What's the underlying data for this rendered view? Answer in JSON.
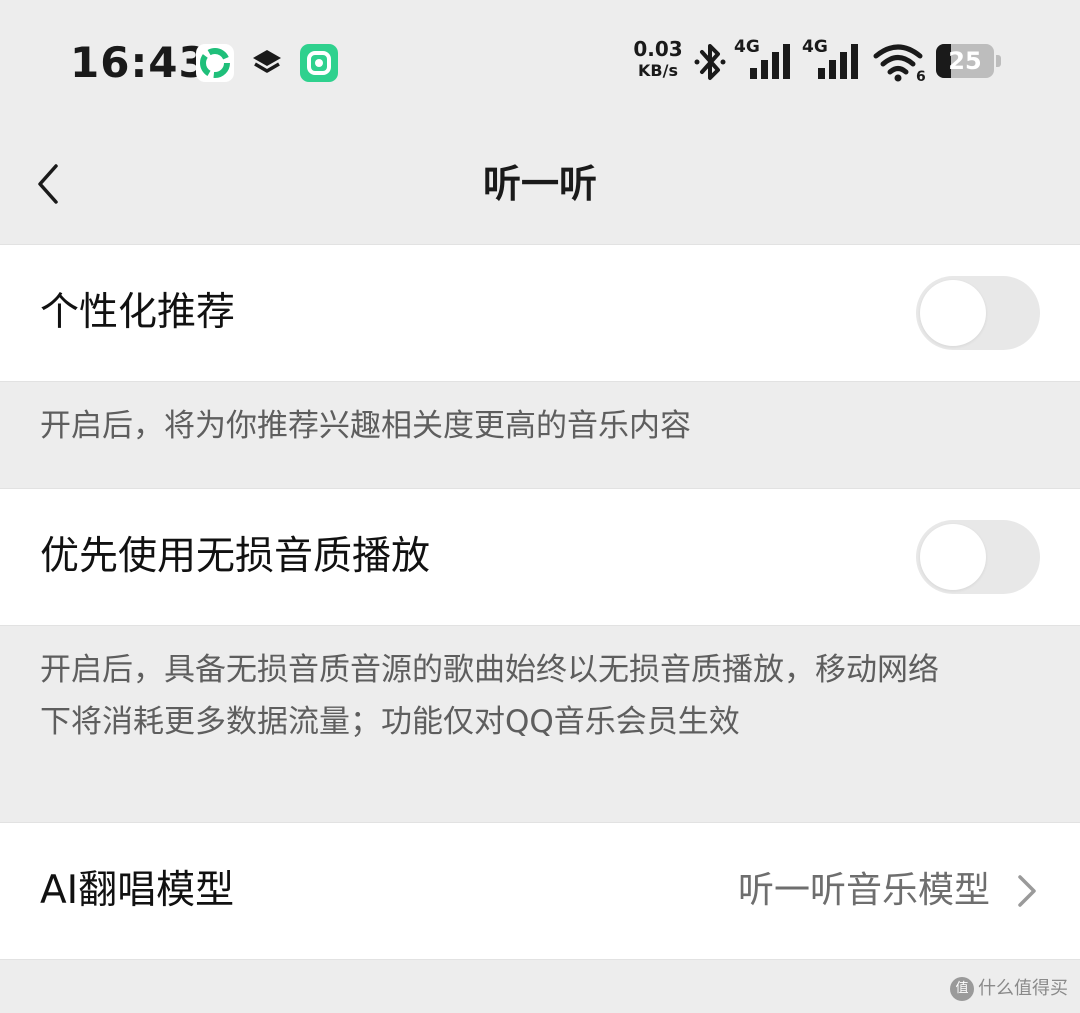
{
  "status_bar": {
    "time": "16:43",
    "net_speed_value": "0.03",
    "net_speed_unit": "KB/s",
    "signal_1_label": "4G",
    "signal_2_label": "4G",
    "wifi_level": "6",
    "battery_level": "25",
    "icons": [
      "green-app-icon",
      "layers-icon",
      "green-app-icon-2",
      "bluetooth-icon",
      "signal-icon",
      "wifi-icon",
      "battery-icon"
    ]
  },
  "nav": {
    "title": "听一听"
  },
  "settings": {
    "personalized": {
      "label": "个性化推荐",
      "enabled": false,
      "description": "开启后，将为你推荐兴趣相关度更高的音乐内容"
    },
    "lossless": {
      "label": "优先使用无损音质播放",
      "enabled": false,
      "description_line1": "开启后，具备无损音质音源的歌曲始终以无损音质播放，移动网络",
      "description_line2": "下将消耗更多数据流量；功能仅对QQ音乐会员生效"
    },
    "ai_model": {
      "label": "AI翻唱模型",
      "value": "听一听音乐模型"
    }
  },
  "watermark": {
    "icon_text": "值",
    "text": "什么值得买"
  },
  "colors": {
    "background": "#ededed",
    "row_background": "#ffffff",
    "toggle_off": "#e8e8e8",
    "secondary_text": "#5e5e5e"
  }
}
